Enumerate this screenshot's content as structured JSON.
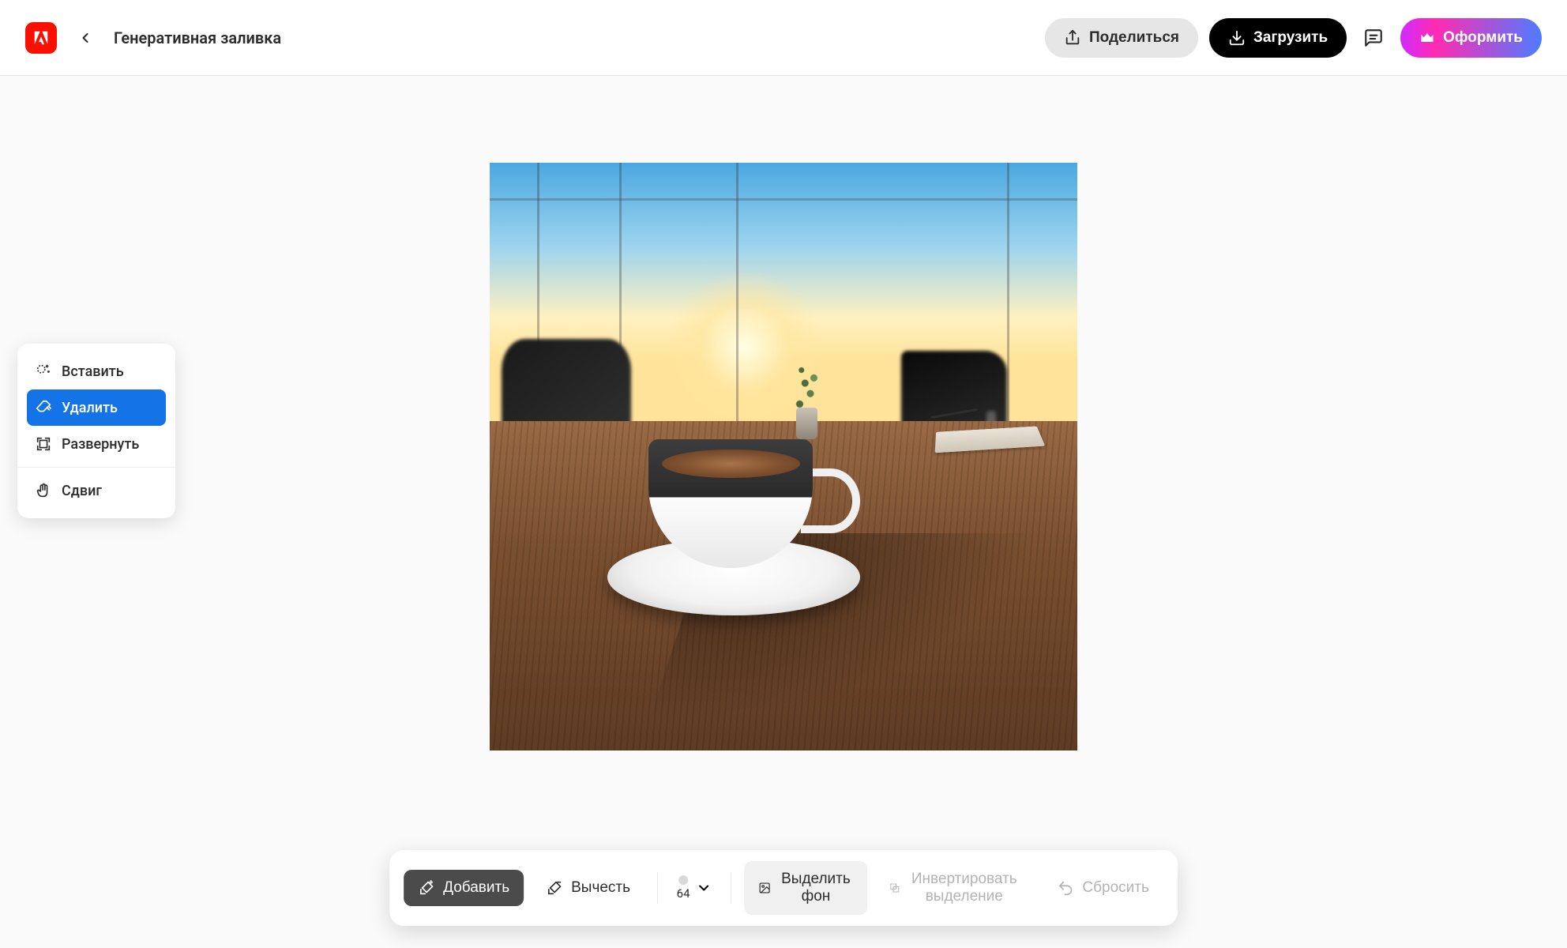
{
  "header": {
    "title": "Генеративная заливка",
    "share_label": "Поделиться",
    "download_label": "Загрузить",
    "upgrade_label": "Оформить"
  },
  "tools": {
    "insert": "Вставить",
    "remove": "Удалить",
    "expand": "Развернуть",
    "pan": "Сдвиг",
    "active": "remove"
  },
  "bottom_bar": {
    "add_label": "Добавить",
    "subtract_label": "Вычесть",
    "brush_size": "64",
    "select_bg_label": "Выделить фон",
    "invert_label": "Инвертировать выделение",
    "reset_label": "Сбросить"
  },
  "canvas": {
    "image_alt": "Чашка кофе на деревянном столе у окна офиса"
  }
}
